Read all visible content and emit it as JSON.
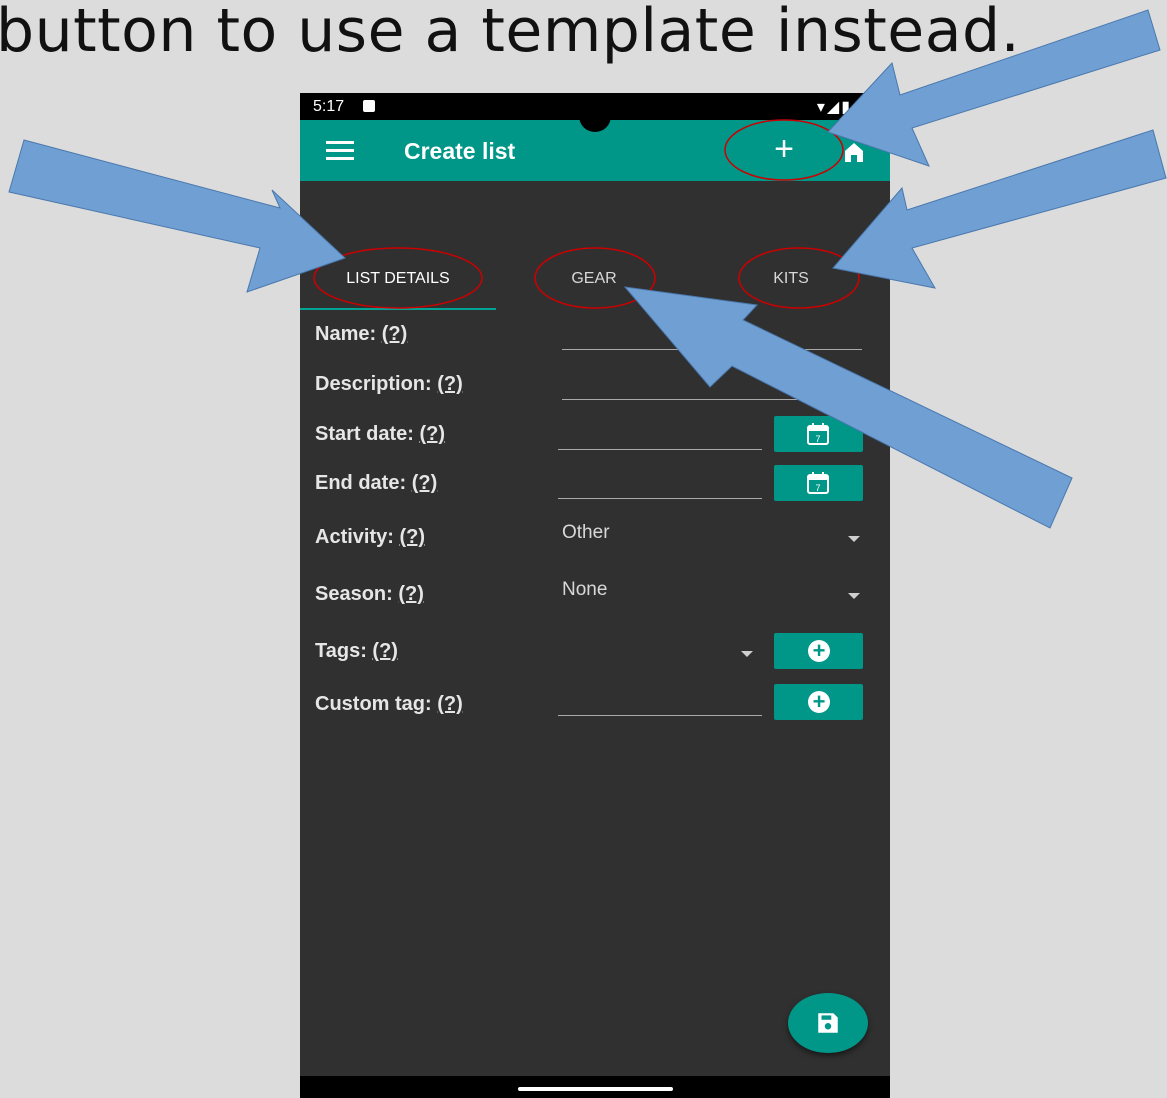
{
  "caption": "button to use a template instead.",
  "status_bar": {
    "time": "5:17"
  },
  "app_bar": {
    "title": "Create list"
  },
  "tabs": [
    {
      "label": "LIST DETAILS"
    },
    {
      "label": "GEAR"
    },
    {
      "label": "KITS"
    }
  ],
  "fields": {
    "name": {
      "label": "Name:",
      "help": "(?)"
    },
    "description": {
      "label": "Description:",
      "help": "(?)"
    },
    "start_date": {
      "label": "Start date:",
      "help": "(?)"
    },
    "end_date": {
      "label": "End date:",
      "help": "(?)"
    },
    "activity": {
      "label": "Activity:",
      "help": "(?)",
      "value": "Other"
    },
    "season": {
      "label": "Season:",
      "help": "(?)",
      "value": "None"
    },
    "tags": {
      "label": "Tags:",
      "help": "(?)"
    },
    "custom_tag": {
      "label": "Custom tag:",
      "help": "(?)"
    }
  },
  "icons": [
    "menu-icon",
    "plus-icon",
    "home-icon",
    "calendar-icon",
    "add-circle-icon",
    "save-icon"
  ],
  "colors": {
    "accent": "#009688",
    "background": "#303030",
    "annotation_arrow": "#6f9fd3",
    "annotation_ellipse": "#cc0000"
  }
}
